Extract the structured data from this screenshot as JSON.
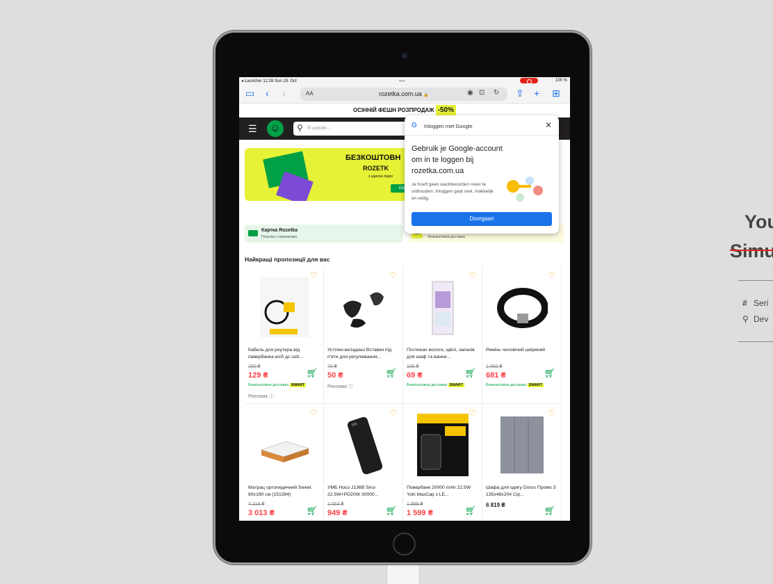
{
  "statusbar": {
    "left": "◂ Launcher  12:28  Sun 19. Oct",
    "dots": "•••",
    "battery": "100 %"
  },
  "browser": {
    "aa": "AA",
    "url": "rozetka.com.ua",
    "lock": "🔒"
  },
  "site": {
    "promo_text": "ОСІННІЙ ФЕШН РОЗПРОДАЖ",
    "promo_pct": "-50%",
    "search_placeholder": "Я шукаю...",
    "banner": {
      "line1": "БЕЗКОШТОВН",
      "line2": "ROZETK",
      "line3": "з єдиною підпи",
      "button": "Офор"
    },
    "card_rozetka": {
      "title": "Картка Rozetka",
      "subtitle": "Покупки з перевагами"
    },
    "card_delivery": {
      "subtitle": "Безкоштовна доставка",
      "badge": "МІС"
    },
    "section_title": "Найкращі пропозиції для вас",
    "free_delivery": "Безкоштовна доставка",
    "smart": "SMART",
    "ad_label": "Реклама ⓘ",
    "products": [
      {
        "name": "Кабель для роутера від павербанка юсб дс usb...",
        "old_price": "250 ₴",
        "price": "129 ₴",
        "free": true,
        "ad": true
      },
      {
        "name": "Устілки-вкладиші Вставки під п'яти для регулювання...",
        "old_price": "70 ₴",
        "price": "50 ₴",
        "free": false,
        "ad": true
      },
      {
        "name": "Поглинач вологи, цвілі, запахів для шаф та ванни...",
        "old_price": "105 ₴",
        "price": "69 ₴",
        "free": true,
        "ad": false
      },
      {
        "name": "Ремінь чоловічий шкіряний",
        "old_price": "1 050 ₴",
        "price": "681 ₴",
        "free": true,
        "ad": false
      },
      {
        "name": "Матрац ортопедичний Sweet 80x190 см (151394)",
        "old_price": "4 218 ₴",
        "price": "3 013 ₴",
        "free": false,
        "ad": false
      },
      {
        "name": "УМБ Hoco J136B Sirui 22.5W+PD20W 30000...",
        "old_price": "1 053 ₴",
        "price": "949 ₴",
        "free": false,
        "ad": false
      },
      {
        "name": "Повербанк 20000 mAh 22.5W Yoki MaxCap з LE...",
        "old_price": "1 899 ₴",
        "price": "1 599 ₴",
        "free": false,
        "ad": false
      },
      {
        "name": "Шафа для одягу Doros Промо 3 135x48x204 Сір...",
        "old_price": "",
        "price": "6 819 ₴",
        "free": false,
        "ad": false
      }
    ]
  },
  "google_popup": {
    "header": "Inloggen met Google",
    "title": "Gebruik je Google-account om in te loggen bij rozetka.com.ua",
    "description": "Je hoeft geen wachtwoorden meer te onthouden. Inloggen gaat snel, makkelijk en veilig.",
    "button": "Doorgaan"
  },
  "side_panel": {
    "title": "You",
    "subtitle": "Simu",
    "row1": "Seri",
    "row2": "Dev"
  },
  "colors": {
    "brand_green": "#00a046",
    "promo_yellow": "#e6f236",
    "price_red": "#f84147",
    "google_blue": "#1a73e8"
  }
}
